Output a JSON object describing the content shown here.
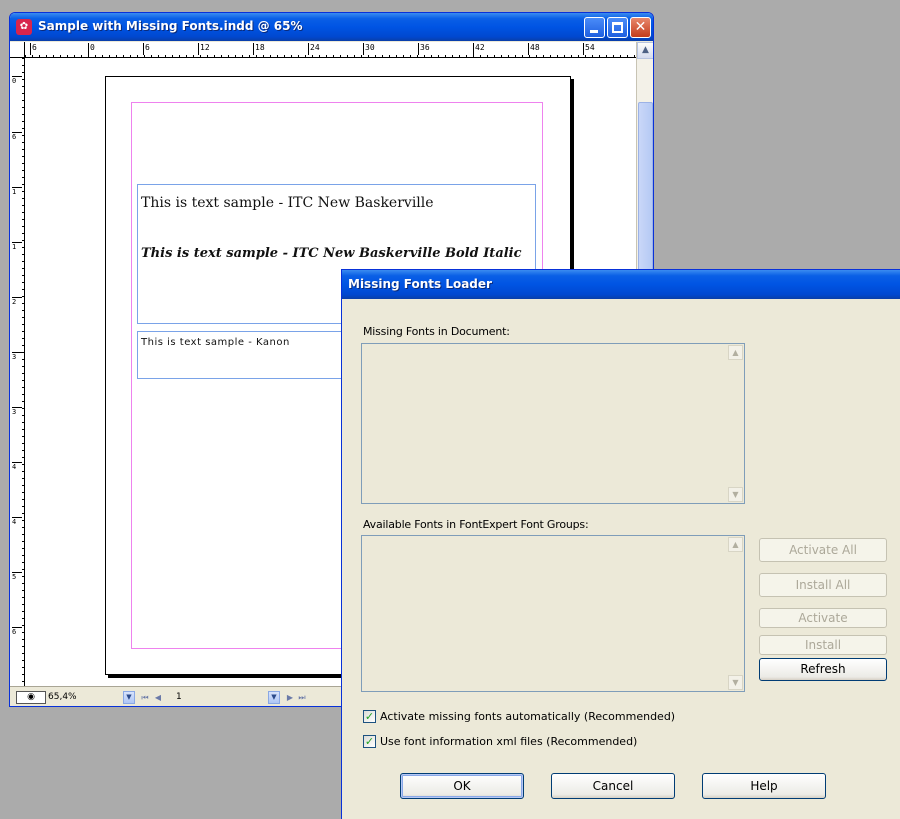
{
  "document_window": {
    "title": "Sample with Missing Fonts.indd @ 65%",
    "app_icon": "indesign-icon",
    "ruler_h_labels": [
      "6",
      "0",
      "6",
      "12",
      "18",
      "24",
      "30",
      "36",
      "42",
      "48",
      "54"
    ],
    "ruler_v_labels": [
      "0",
      "6",
      "1",
      "1",
      "2",
      "3",
      "3",
      "4",
      "4",
      "5",
      "6"
    ],
    "text_samples": [
      "This is text sample - ITC New Baskerville",
      "This is text sample - ITC New Baskerville Bold Italic",
      "This is text sample - Kanon"
    ],
    "status": {
      "zoom": "65,4%",
      "page": "1"
    }
  },
  "dialog": {
    "title": "Missing Fonts Loader",
    "missing_label": "Missing Fonts in Document:",
    "available_label": "Available Fonts in FontExpert Font Groups:",
    "buttons": {
      "activate_all": "Activate All",
      "install_all": "Install All",
      "activate": "Activate",
      "install": "Install",
      "refresh": "Refresh",
      "ok": "OK",
      "cancel": "Cancel",
      "help": "Help"
    },
    "checkboxes": [
      {
        "label": "Activate missing fonts automatically (Recommended)",
        "checked": true
      },
      {
        "label": "Use font information xml files (Recommended)",
        "checked": true
      }
    ]
  }
}
